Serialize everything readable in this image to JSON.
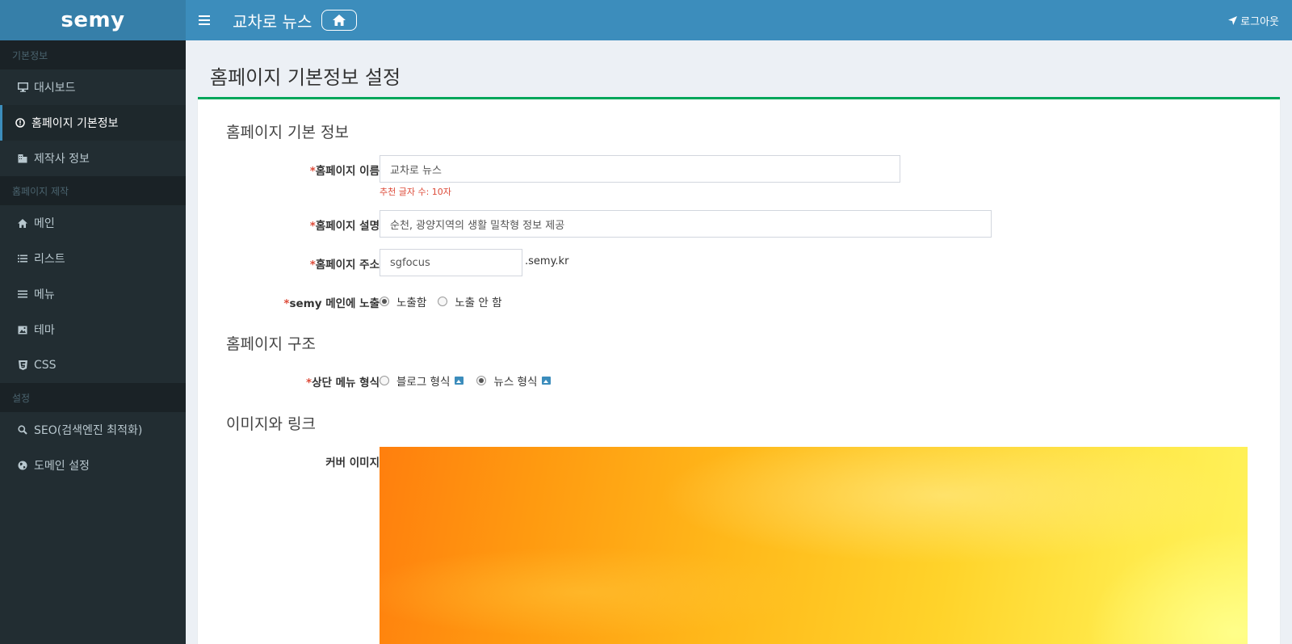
{
  "app": {
    "logo": "semy"
  },
  "header": {
    "site_title": "교차로 뉴스",
    "logout_label": "로그아웃"
  },
  "sidebar": {
    "sections": [
      {
        "header": "기본정보",
        "items": [
          {
            "label": "대시보드",
            "icon": "monitor-icon"
          },
          {
            "label": "홈페이지 기본정보",
            "icon": "info-circle-icon",
            "active": true
          },
          {
            "label": "제작사 정보",
            "icon": "building-icon"
          }
        ]
      },
      {
        "header": "홈페이지 제작",
        "items": [
          {
            "label": "메인",
            "icon": "home-icon"
          },
          {
            "label": "리스트",
            "icon": "list-icon"
          },
          {
            "label": "메뉴",
            "icon": "bars-icon"
          },
          {
            "label": "테마",
            "icon": "image-icon"
          },
          {
            "label": "CSS",
            "icon": "css3-icon"
          }
        ]
      },
      {
        "header": "설정",
        "items": [
          {
            "label": "SEO(검색엔진 최적화)",
            "icon": "search-icon"
          },
          {
            "label": "도메인 설정",
            "icon": "globe-icon"
          }
        ]
      }
    ]
  },
  "main": {
    "page_title": "홈페이지 기본정보 설정",
    "basic": {
      "title": "홈페이지 기본 정보",
      "required_mark": "*",
      "name_label": "홈페이지 이름",
      "name_value": "교차로 뉴스",
      "name_help": "추천 글자 수: 10자",
      "desc_label": "홈페이지 설명",
      "desc_value": "순천, 광양지역의 생활 밀착형 정보 제공",
      "addr_label": "홈페이지 주소",
      "addr_value": "sgfocus",
      "addr_suffix": ".semy.kr",
      "expose_label": "semy 메인에 노출",
      "expose_options": [
        "노출함",
        "노출 안 함"
      ],
      "expose_selected": "노출함"
    },
    "structure": {
      "title": "홈페이지 구조",
      "menu_label": "상단 메뉴 형식",
      "menu_options": [
        "블로그 형식",
        "뉴스 형식"
      ],
      "menu_selected": "뉴스 형식"
    },
    "images": {
      "title": "이미지와 링크",
      "cover_label": "커버 이미지"
    }
  },
  "colors": {
    "sidebar_bg": "#222d32",
    "header_bg": "#3c8dbc",
    "accent_green": "#00a65a",
    "required_red": "#dd4b39"
  }
}
